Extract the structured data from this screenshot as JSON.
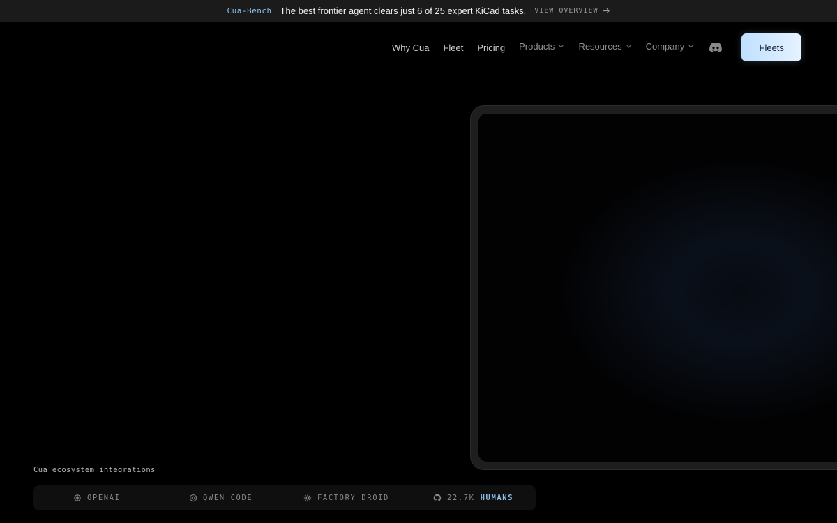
{
  "announcement": {
    "tag": "Cua-Bench",
    "message": "The best frontier agent clears just 6 of 25 expert KiCad tasks.",
    "link_label": "VIEW OVERVIEW",
    "link_icon": "arrow-right-icon"
  },
  "nav": {
    "links": [
      "Why Cua",
      "Fleet",
      "Pricing"
    ],
    "dropdowns": [
      "Products",
      "Resources",
      "Company"
    ],
    "discord_icon": "discord-icon",
    "cta_label": "Fleets"
  },
  "integrations": {
    "label": "Cua ecosystem integrations",
    "items": [
      {
        "icon": "openai-icon",
        "label": "OPENAI"
      },
      {
        "icon": "qwen-icon",
        "label": "QWEN CODE"
      },
      {
        "icon": "factory-droid-icon",
        "label": "FACTORY DROID"
      },
      {
        "icon": "github-icon",
        "label": "22.7K",
        "highlight": "HUMANS"
      }
    ]
  },
  "colors": {
    "accent": "#8fc1ea",
    "cta_gradient_start": "#bfe0ff",
    "cta_gradient_end": "#e6f2ff",
    "background": "#000000"
  }
}
